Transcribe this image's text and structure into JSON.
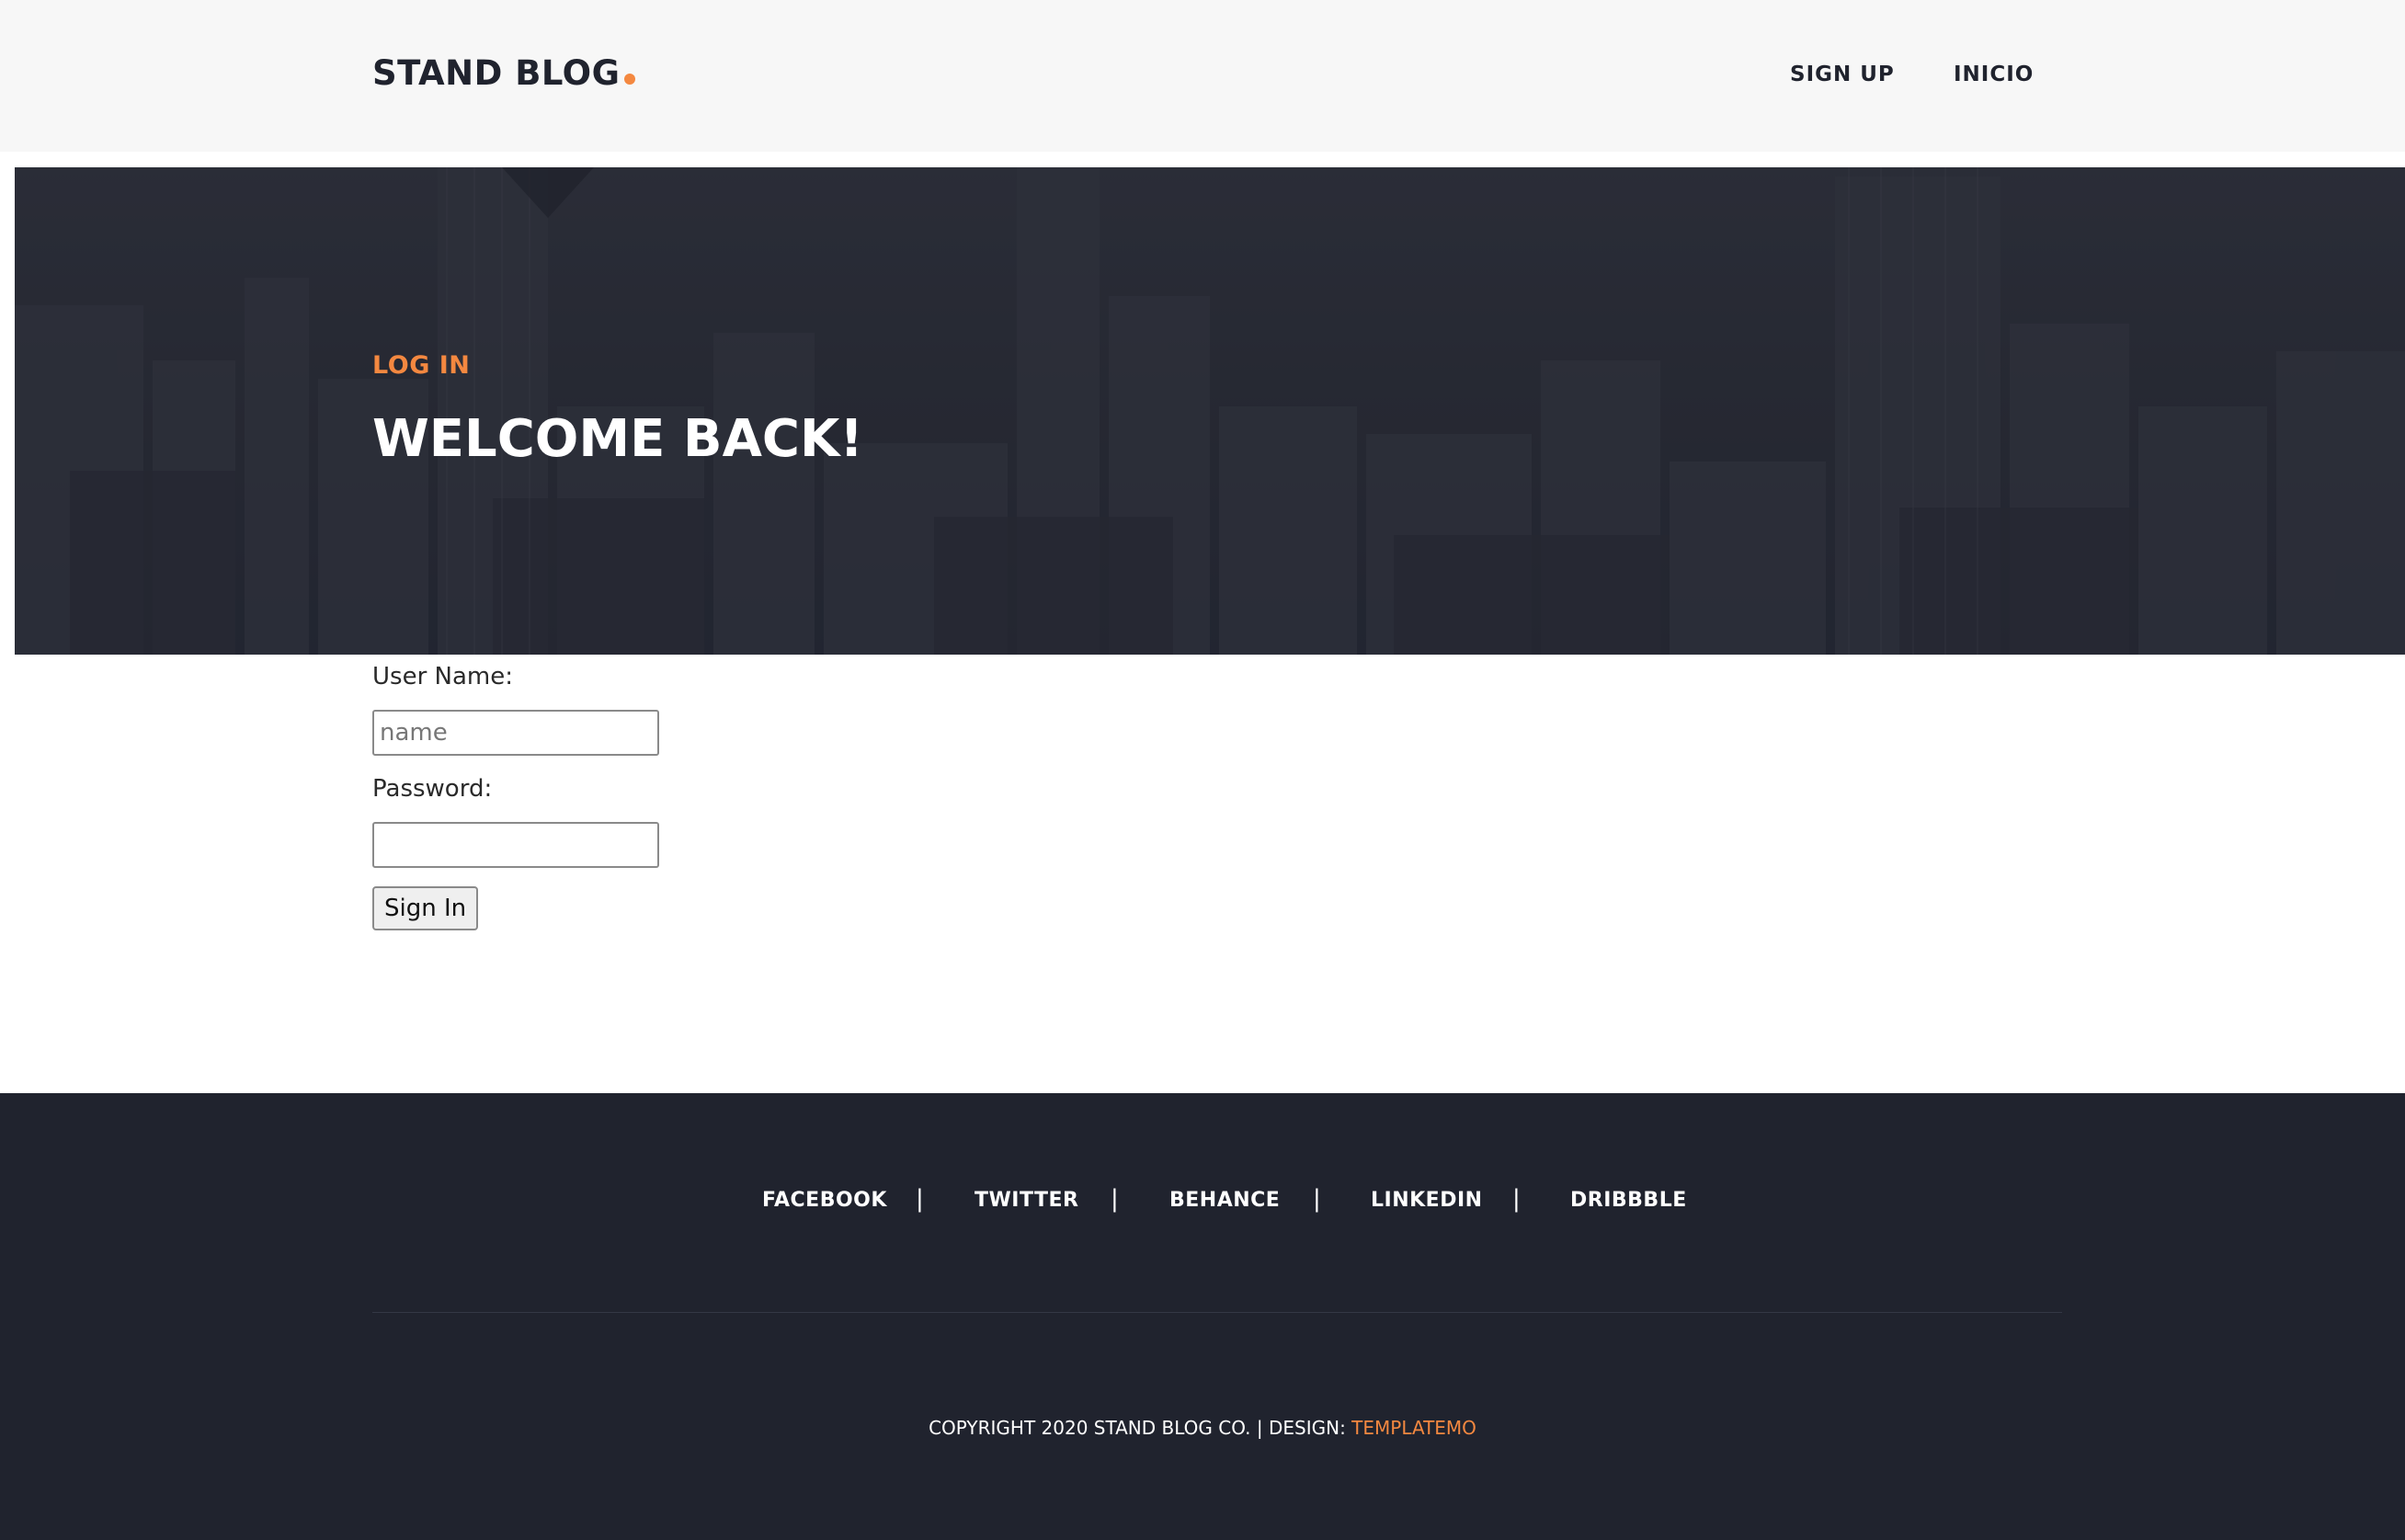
{
  "header": {
    "logo_text": "STAND BLOG",
    "nav": [
      {
        "label": "SIGN UP"
      },
      {
        "label": "INICIO"
      }
    ]
  },
  "hero": {
    "kicker": "LOG IN",
    "title": "WELCOME BACK!"
  },
  "form": {
    "username_label": "User Name:",
    "username_placeholder": "name",
    "username_value": "",
    "password_label": "Password:",
    "password_value": "",
    "submit_label": "Sign In"
  },
  "footer": {
    "social": [
      {
        "label": "FACEBOOK"
      },
      {
        "label": "TWITTER"
      },
      {
        "label": "BEHANCE"
      },
      {
        "label": "LINKEDIN"
      },
      {
        "label": "DRIBBBLE"
      }
    ],
    "separator": "|",
    "copyright_text": "COPYRIGHT 2020 STAND BLOG CO. | DESIGN: ",
    "copyright_link": "TEMPLATEMO"
  },
  "colors": {
    "accent": "#f48840",
    "dark": "#20232e",
    "header_bg": "#f7f7f7"
  }
}
